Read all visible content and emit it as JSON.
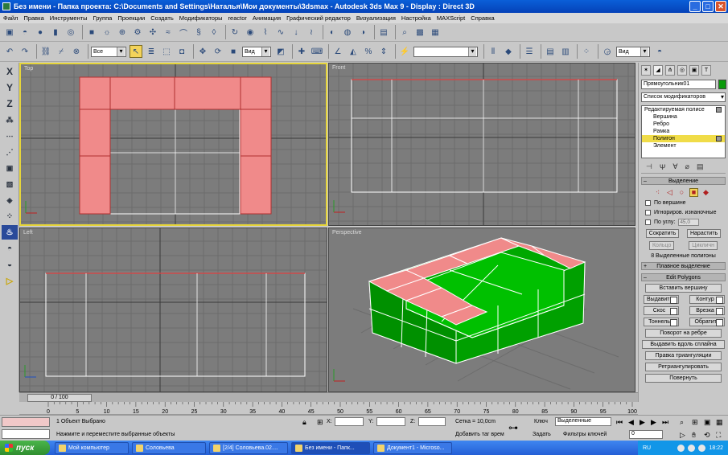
{
  "window": {
    "title": "Без имени     - Папка проекта: C:\\Documents and Settings\\Наталья\\Мои документы\\3dsmax     - Autodesk 3ds Max 9     - Display : Direct 3D",
    "btn_min": "_",
    "btn_max": "□",
    "btn_close": "✕"
  },
  "menu": [
    "Файл",
    "Правка",
    "Инструменты",
    "Группа",
    "Проекции",
    "Создать",
    "Модификаторы",
    "reactor",
    "Анимация",
    "Графический редактор",
    "Визуализация",
    "Настройка",
    "MAXScript",
    "Справка"
  ],
  "toolbar2": {
    "selection_filter": "Все",
    "ref_coord": "Вид",
    "named_sel": "",
    "view_combo": "Вид"
  },
  "left_toolbar": [
    "X",
    "Y",
    "Z"
  ],
  "viewports": {
    "top": "Top",
    "front": "Front",
    "left": "Left",
    "perspective": "Perspective"
  },
  "command_panel": {
    "object_name": "Прямоугольник01",
    "modifier_list": "Список модификаторов",
    "stack": {
      "root": "Редактируемая полисе",
      "items": [
        "Вершина",
        "Ребро",
        "Рамка",
        "Полигон",
        "Элемент"
      ],
      "selected_index": 3
    },
    "selection": {
      "header": "Выделение",
      "by_vertex": "По вершине",
      "ignore_backfacing": "Игнориров. изнаночные",
      "by_angle": "По углу:",
      "angle_value": "45,0",
      "shrink": "Сократить",
      "grow": "Нарастить",
      "ring": "Кольцо",
      "loop": "Цикличн",
      "info": "8 Выделенные полигоны"
    },
    "soft_selection": "Плавное выделение",
    "edit_polygons": {
      "header": "Edit Polygons",
      "insert_vertex": "Вставить вершину",
      "extrude": "Выдавить",
      "outline": "Контур",
      "bevel": "Скос",
      "inset": "Врезка",
      "bridge": "Тоннель",
      "flip": "Обратить",
      "hinge": "Поворот на ребре",
      "extrude_spline": "Выдавить вдоль сплайна",
      "edit_tri": "Правка триангуляции",
      "retriangulate": "Ретриангулировать",
      "turn": "Повернуть"
    }
  },
  "timeline": {
    "slider": "0 / 100",
    "ticks": [
      "0",
      "5",
      "10",
      "15",
      "20",
      "25",
      "30",
      "35",
      "40",
      "45",
      "50",
      "55",
      "60",
      "65",
      "70",
      "75",
      "80",
      "85",
      "90",
      "95",
      "100"
    ]
  },
  "status": {
    "selected": "1 Объект Выбрано",
    "prompt": "Нажмите и переместите выбранные объекты",
    "x_label": "X:",
    "y_label": "Y:",
    "z_label": "Z:",
    "grid": "Сетка = 10,0cm",
    "add_time_tag": "Добавить таг врем",
    "key_label": "Ключ",
    "key_mode": "Выделенные",
    "set_label": "Задать",
    "key_filters": "Фильтры ключей",
    "frame": "0"
  },
  "taskbar": {
    "start": "пуск",
    "tasks": [
      "Мой компьютер",
      "Соловьева",
      "[2/4] Соловьева.02....",
      "Без имени    - Папк...",
      "Документ1 - Microso..."
    ],
    "active_index": 3,
    "lang": "RU",
    "clock": "18:22"
  },
  "colors": {
    "selected_face": "#f08080",
    "object": "#00b000",
    "active_viewport": "#e6d53a",
    "viewport_bg": "#7c7c7c"
  }
}
